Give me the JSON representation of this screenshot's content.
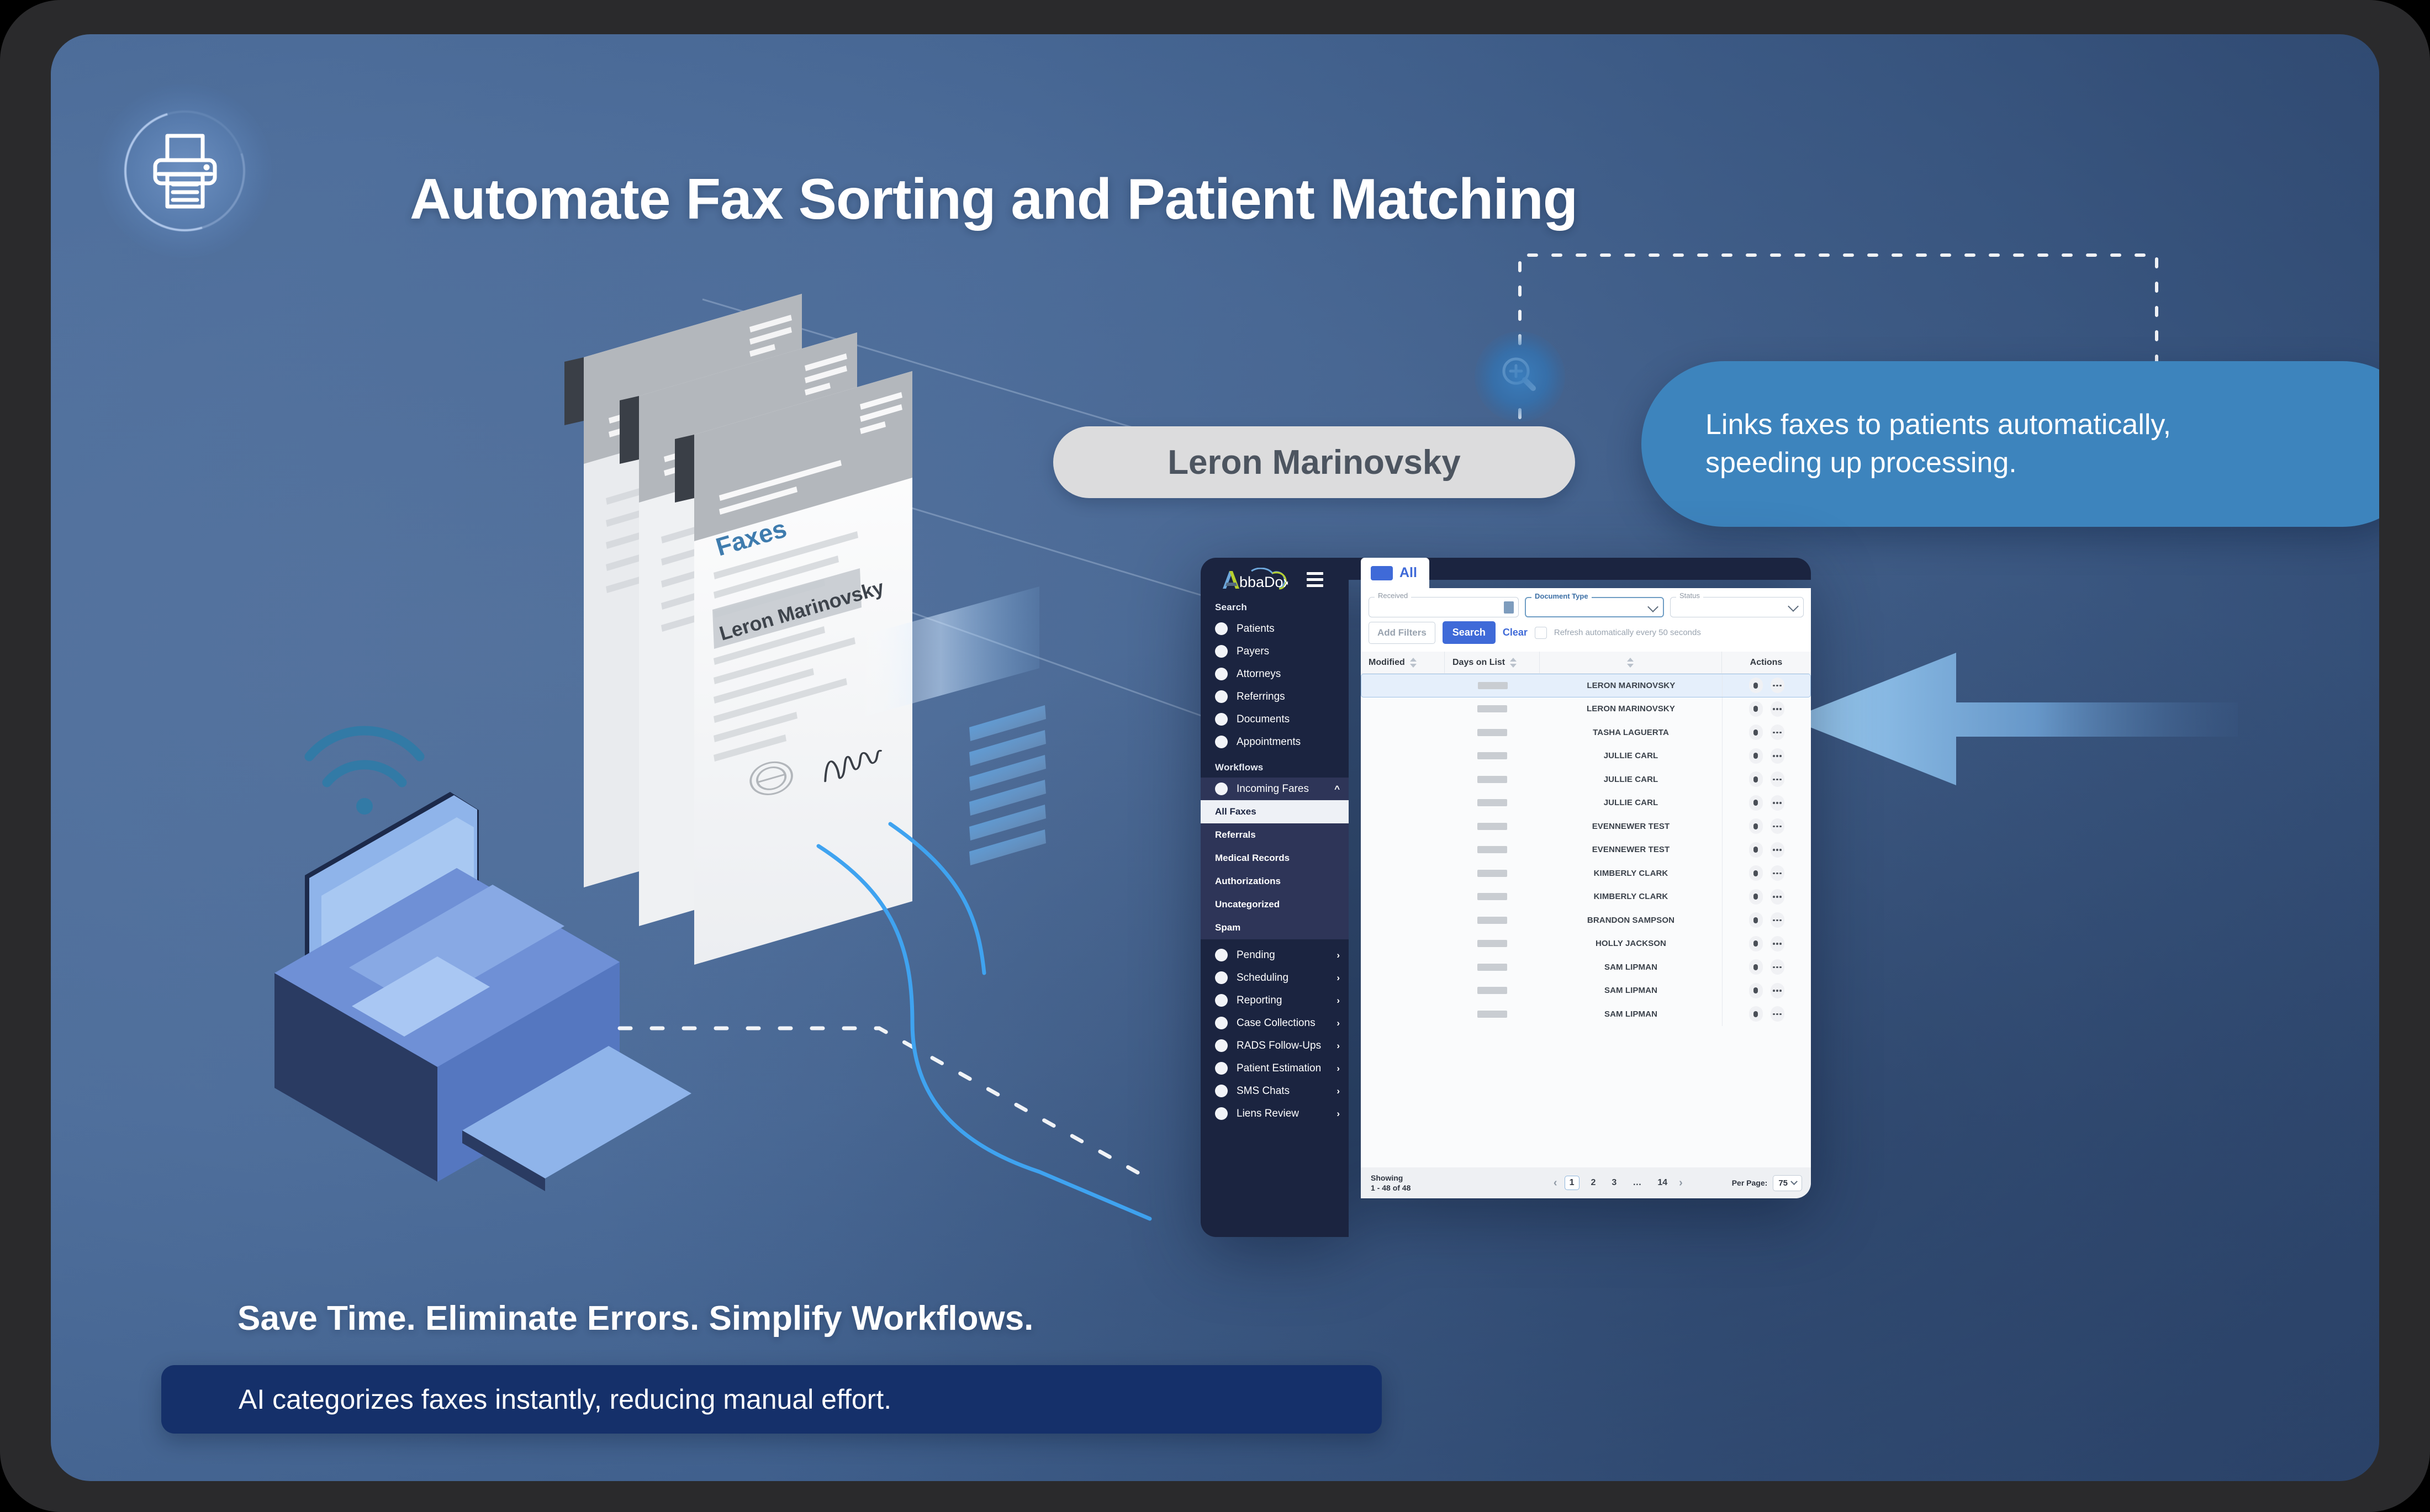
{
  "header": {
    "title": "Automate Fax Sorting and Patient Matching",
    "printer_icon": "printer-icon"
  },
  "illustration": {
    "fax_doc_title": "Faxes",
    "fax_doc_name": "Leron Marinovsky",
    "printer_icon": "printer-isometric",
    "wifi_icon": "wifi-icon",
    "signature_icon": "signature-icon",
    "seal_icon": "seal-icon"
  },
  "name_pill": {
    "label": "Leron Marinovsky"
  },
  "magnifier": {
    "icon": "magnifier-plus-icon"
  },
  "callout": {
    "line1": "Links faxes to patients automatically,",
    "line2": "speeding up processing."
  },
  "app": {
    "logo": "AbbaDox",
    "menu_icon": "hamburger-icon",
    "sidebar": {
      "search_section": "Search",
      "search_items": [
        {
          "label": "Patients"
        },
        {
          "label": "Payers"
        },
        {
          "label": "Attorneys"
        },
        {
          "label": "Referrings"
        },
        {
          "label": "Documents"
        },
        {
          "label": "Appointments"
        }
      ],
      "workflows_section": "Workflows",
      "incoming": {
        "label": "Incoming Fares",
        "chevron": "chevron-up-icon"
      },
      "sub_items": [
        {
          "label": "All Faxes",
          "selected": true
        },
        {
          "label": "Referrals",
          "selected": false
        },
        {
          "label": "Medical Records",
          "selected": false
        },
        {
          "label": "Authorizations",
          "selected": false
        },
        {
          "label": "Uncategorized",
          "selected": false
        },
        {
          "label": "Spam",
          "selected": false
        }
      ],
      "workflow_items": [
        {
          "label": "Pending"
        },
        {
          "label": "Scheduling"
        },
        {
          "label": "Reporting"
        },
        {
          "label": "Case Collections"
        },
        {
          "label": "RADS Follow-Ups"
        },
        {
          "label": "Patient Estimation"
        },
        {
          "label": "SMS Chats"
        },
        {
          "label": "Liens Review"
        }
      ]
    },
    "tab": {
      "label": "All"
    },
    "filters": {
      "received_label": "Received",
      "received_value": "",
      "document_type_label": "Document Type",
      "document_type_value": "",
      "status_label": "Status",
      "status_value": "",
      "add_filters": "Add Filters",
      "search": "Search",
      "clear": "Clear",
      "refresh_label": "Refresh automatically every 50 seconds",
      "refresh_checked": false
    },
    "table": {
      "columns": [
        "Modified",
        "Days on List",
        "",
        "Actions"
      ],
      "rows": [
        {
          "name": "LERON MARINOVSKY",
          "selected": true
        },
        {
          "name": "LERON MARINOVSKY",
          "selected": false
        },
        {
          "name": "TASHA LAGUERTA",
          "selected": false
        },
        {
          "name": "JULLIE CARL",
          "selected": false
        },
        {
          "name": "JULLIE CARL",
          "selected": false
        },
        {
          "name": "JULLIE CARL",
          "selected": false
        },
        {
          "name": "EVENNEWER TEST",
          "selected": false
        },
        {
          "name": "EVENNEWER TEST",
          "selected": false
        },
        {
          "name": "KIMBERLY CLARK",
          "selected": false
        },
        {
          "name": "KIMBERLY CLARK",
          "selected": false
        },
        {
          "name": "BRANDON SAMPSON",
          "selected": false
        },
        {
          "name": "HOLLY JACKSON",
          "selected": false
        },
        {
          "name": "SAM LIPMAN",
          "selected": false
        },
        {
          "name": "SAM LIPMAN",
          "selected": false
        },
        {
          "name": "SAM LIPMAN",
          "selected": false
        }
      ]
    },
    "footer": {
      "showing_label": "Showing",
      "showing_range": "1 - 48 of 48",
      "pages": [
        "1",
        "2",
        "3",
        "…",
        "14"
      ],
      "current_page": "1",
      "prev_icon": "chevron-left-icon",
      "next_icon": "chevron-right-icon",
      "per_page_label": "Per Page:",
      "per_page_value": "75"
    }
  },
  "footer_copy": {
    "tagline": "Save Time. Eliminate Errors. Simplify Workflows.",
    "subbar": "AI categorizes faxes instantly, reducing manual effort."
  },
  "colors": {
    "bg_blue": "#4c6c99",
    "panel_dark": "#1b2440",
    "accent_blue": "#3f6ad8",
    "callout_blue": "#3d84bd",
    "subbar_navy": "#15306a",
    "pill_gray": "#dcdcdd"
  }
}
